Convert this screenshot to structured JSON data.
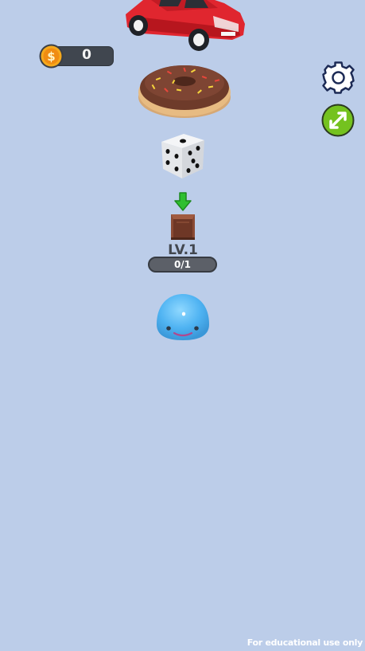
{
  "hud": {
    "coin_count": "0",
    "coin_symbol": "$"
  },
  "station": {
    "level_label": "LV.1",
    "progress_text": "0/1",
    "progress_current": 0,
    "progress_total": 1
  },
  "objects": {
    "car": "red-car",
    "donut": "chocolate-donut",
    "dice": "white-dice",
    "crate": "brown-crate",
    "player": "blue-slime"
  },
  "icons": {
    "settings": "gear-icon",
    "expand": "expand-arrows-icon",
    "drop_arrow": "down-arrow-icon"
  },
  "colors": {
    "background": "#bccde9",
    "coin": "#f5a623",
    "expand_button": "#74c21f",
    "arrow": "#2fbf2f",
    "slime": "#4fb3f2"
  },
  "footer": {
    "watermark": "For educational use only"
  }
}
